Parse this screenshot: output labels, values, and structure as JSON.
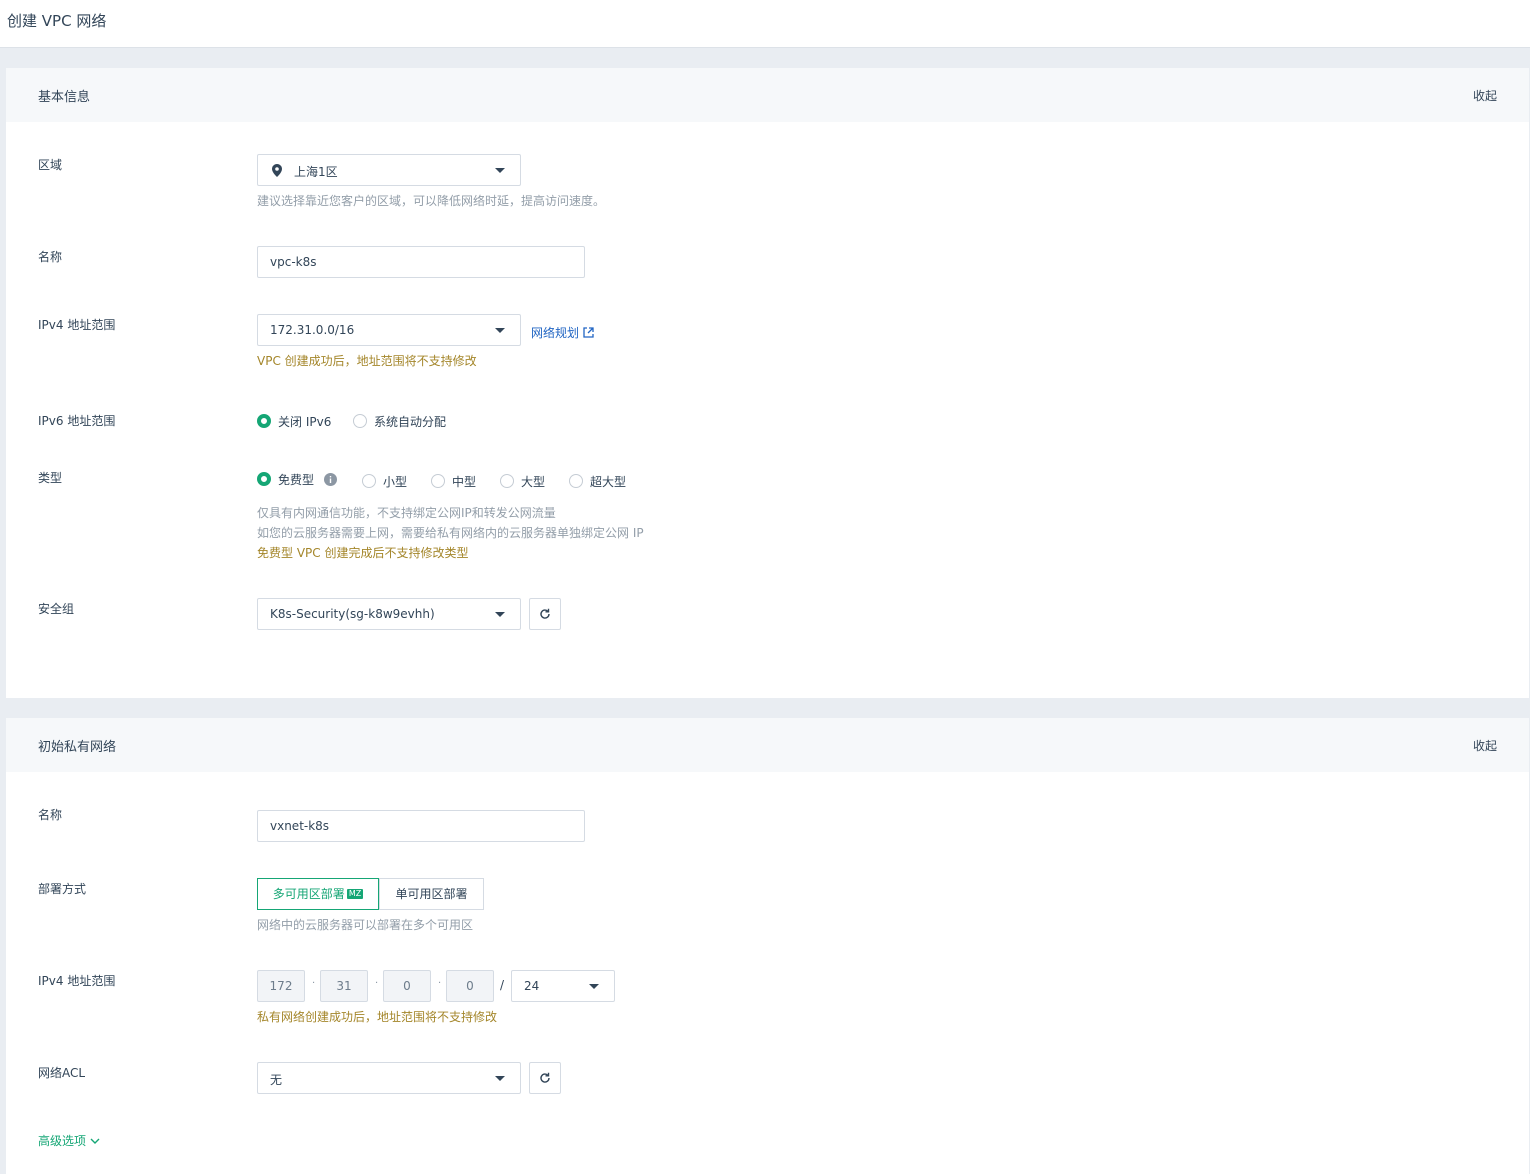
{
  "page": {
    "title": "创建 VPC 网络"
  },
  "basic": {
    "title": "基本信息",
    "collapse": "收起",
    "region": {
      "label": "区域",
      "value": "上海1区",
      "hint": "建议选择靠近您客户的区域，可以降低网络时延，提高访问速度。"
    },
    "name": {
      "label": "名称",
      "value": "vpc-k8s"
    },
    "ipv4": {
      "label": "IPv4 地址范围",
      "value": "172.31.0.0/16",
      "link": "网络规划",
      "warn": "VPC 创建成功后，地址范围将不支持修改"
    },
    "ipv6": {
      "label": "IPv6 地址范围",
      "options": [
        "关闭 IPv6",
        "系统自动分配"
      ],
      "selected": 0
    },
    "type": {
      "label": "类型",
      "options": [
        "免费型",
        "小型",
        "中型",
        "大型",
        "超大型"
      ],
      "selected": 0,
      "hint1": "仅具有内网通信功能，不支持绑定公网IP和转发公网流量",
      "hint2": "如您的云服务器需要上网，需要给私有网络内的云服务器单独绑定公网 IP",
      "warn": "免费型 VPC 创建完成后不支持修改类型"
    },
    "security": {
      "label": "安全组",
      "value": "K8s-Security(sg-k8w9evhh)"
    }
  },
  "vxnet": {
    "title": "初始私有网络",
    "collapse": "收起",
    "name": {
      "label": "名称",
      "value": "vxnet-k8s"
    },
    "deploy": {
      "label": "部署方式",
      "options": [
        "多可用区部署",
        "单可用区部署"
      ],
      "badge": "MZ",
      "hint": "网络中的云服务器可以部署在多个可用区"
    },
    "ipv4": {
      "label": "IPv4 地址范围",
      "octets": [
        "172",
        "31",
        "0",
        "0"
      ],
      "sep": "·",
      "slash": "/",
      "mask": "24",
      "warn": "私有网络创建成功后，地址范围将不支持修改"
    },
    "acl": {
      "label": "网络ACL",
      "value": "无"
    },
    "advanced": "高级选项"
  },
  "colors": {
    "accent": "#15a675",
    "link": "#2165c3",
    "warn": "#a4862a"
  },
  "icons": [
    "location-pin-icon",
    "caret-down-icon",
    "external-link-icon",
    "info-icon",
    "refresh-icon",
    "chevron-down-icon"
  ]
}
